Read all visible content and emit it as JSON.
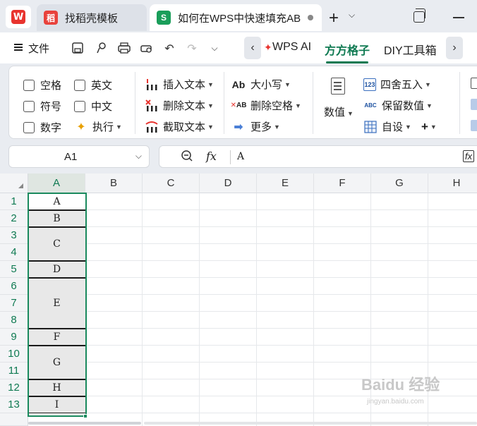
{
  "tabs": [
    {
      "label": "找稻壳模板",
      "icon": "docer-icon"
    },
    {
      "label": "如何在WPS中快速填充AB",
      "icon": "S"
    }
  ],
  "menu": {
    "file": "文件",
    "nav_tabs": [
      "WPS AI",
      "方方格子",
      "DIY工具箱"
    ]
  },
  "ribbon": {
    "checkboxes": [
      "空格",
      "英文",
      "符号",
      "中文",
      "数字"
    ],
    "execute": "执行",
    "text_ops": [
      "插入文本",
      "删除文本",
      "截取文本"
    ],
    "case_ops": [
      "大小写",
      "删除空格",
      "更多"
    ],
    "value_label": "数值",
    "num_ops": [
      "四舍五入",
      "保留数值",
      "自设"
    ],
    "case_icon_text": "Ab",
    "delspace_icon_text": "AB",
    "round_icon_text": "123",
    "keep_icon_text": "ABC"
  },
  "formula_bar": {
    "cell_ref": "A1",
    "fx_label": "fx",
    "value": "A"
  },
  "sheet": {
    "columns": [
      "A",
      "B",
      "C",
      "D",
      "E",
      "F",
      "G",
      "H"
    ],
    "rows": [
      "1",
      "2",
      "3",
      "4",
      "5",
      "6",
      "7",
      "8",
      "9",
      "10",
      "11",
      "12",
      "13"
    ],
    "cells": [
      "A",
      "B",
      "C",
      "D",
      "E",
      "F",
      "G",
      "H",
      "I"
    ]
  },
  "watermark": {
    "text": "Baidu 经验",
    "url": "jingyan.baidu.com"
  }
}
